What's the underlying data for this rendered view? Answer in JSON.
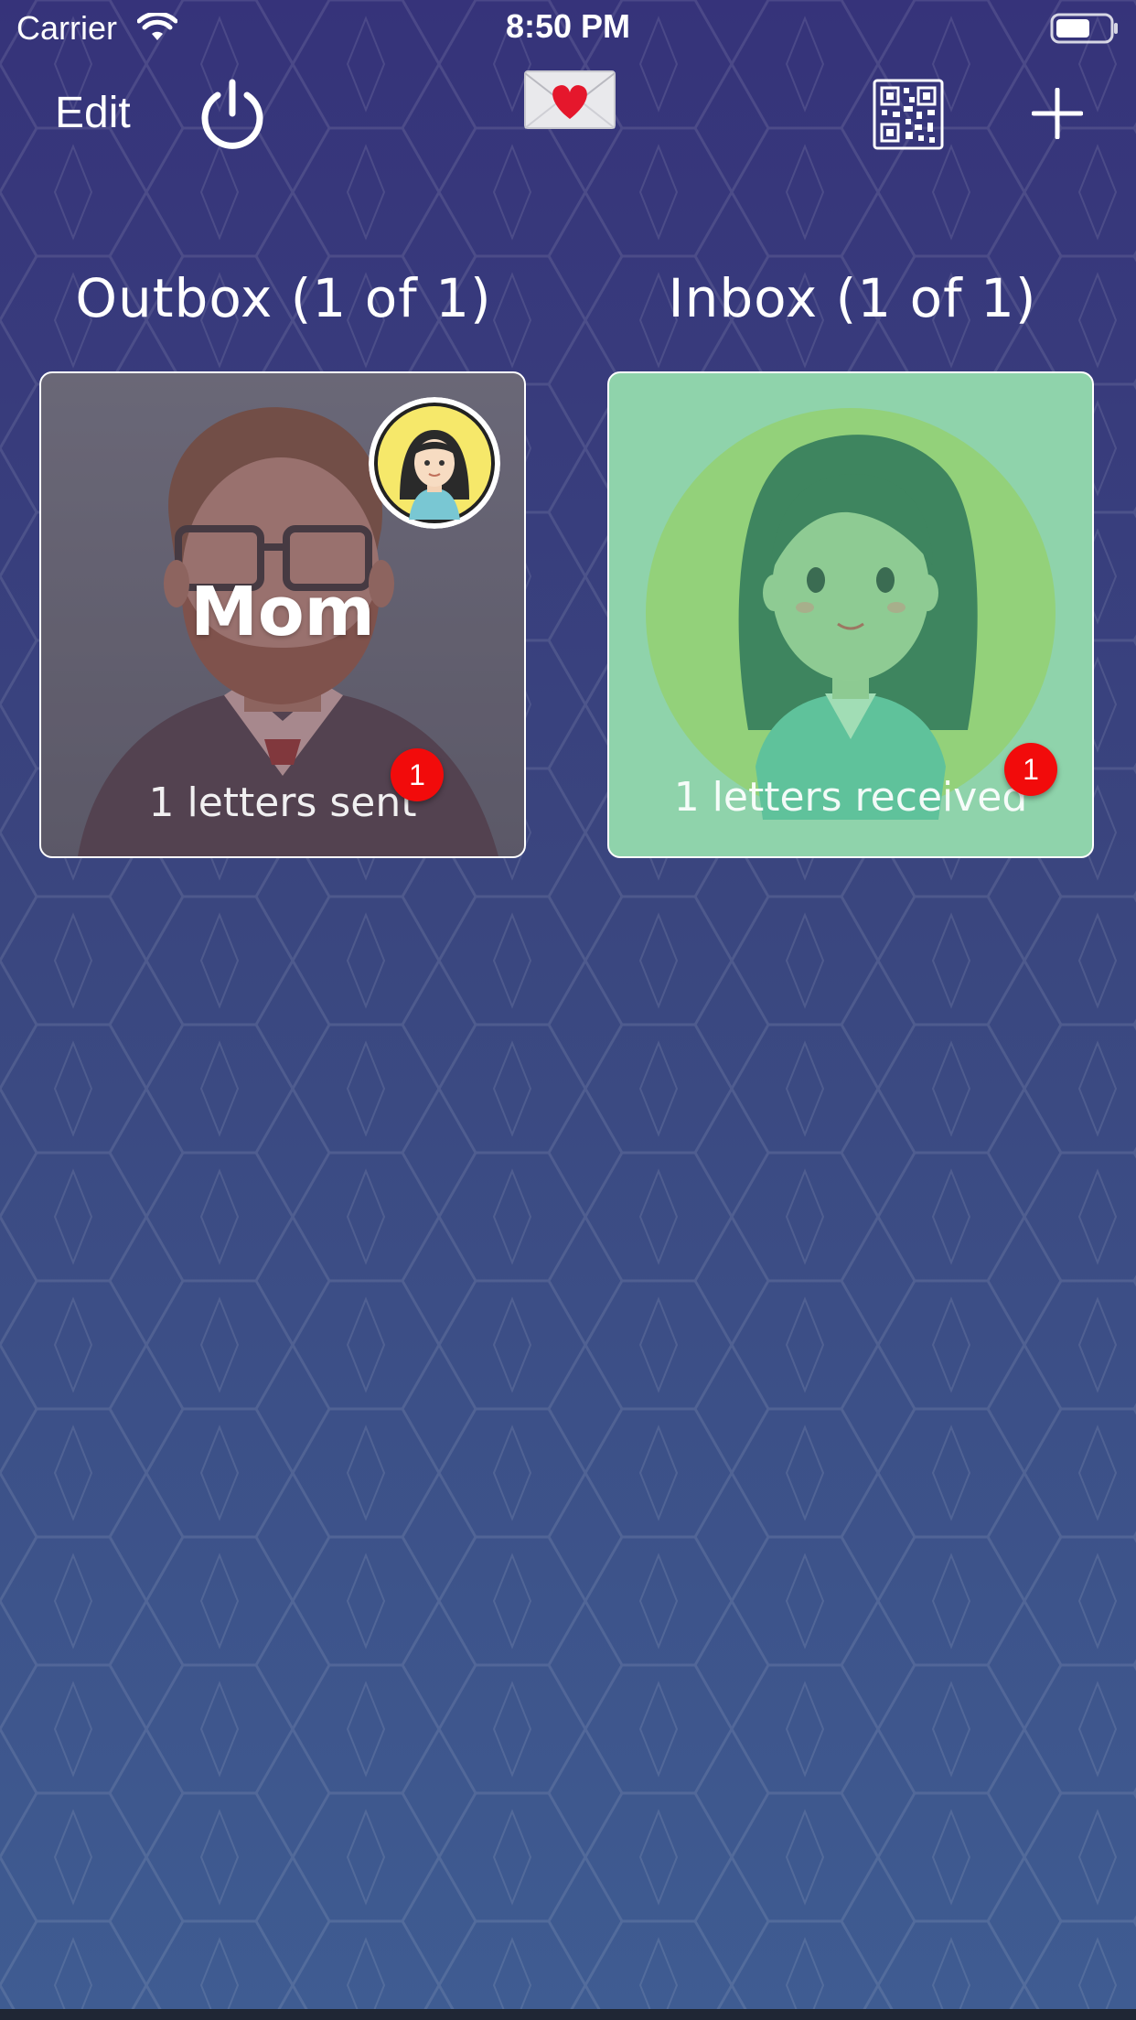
{
  "status_bar": {
    "carrier": "Carrier",
    "time": "8:50 PM"
  },
  "nav": {
    "edit_label": "Edit",
    "icons": [
      "power-icon",
      "love-letter-icon",
      "qr-code-icon",
      "plus-icon"
    ]
  },
  "outbox": {
    "title": "Outbox (1 of 1)",
    "contact_name": "Mom",
    "caption": "1 letters sent",
    "badge": "1"
  },
  "inbox": {
    "title": "Inbox (1 of 1)",
    "caption": "1 letters received",
    "badge": "1"
  },
  "colors": {
    "background_top": "#36337a",
    "background_bottom": "#3f5c92",
    "badge": "#f20b0b",
    "inbox_card": "#8fd3ab"
  }
}
